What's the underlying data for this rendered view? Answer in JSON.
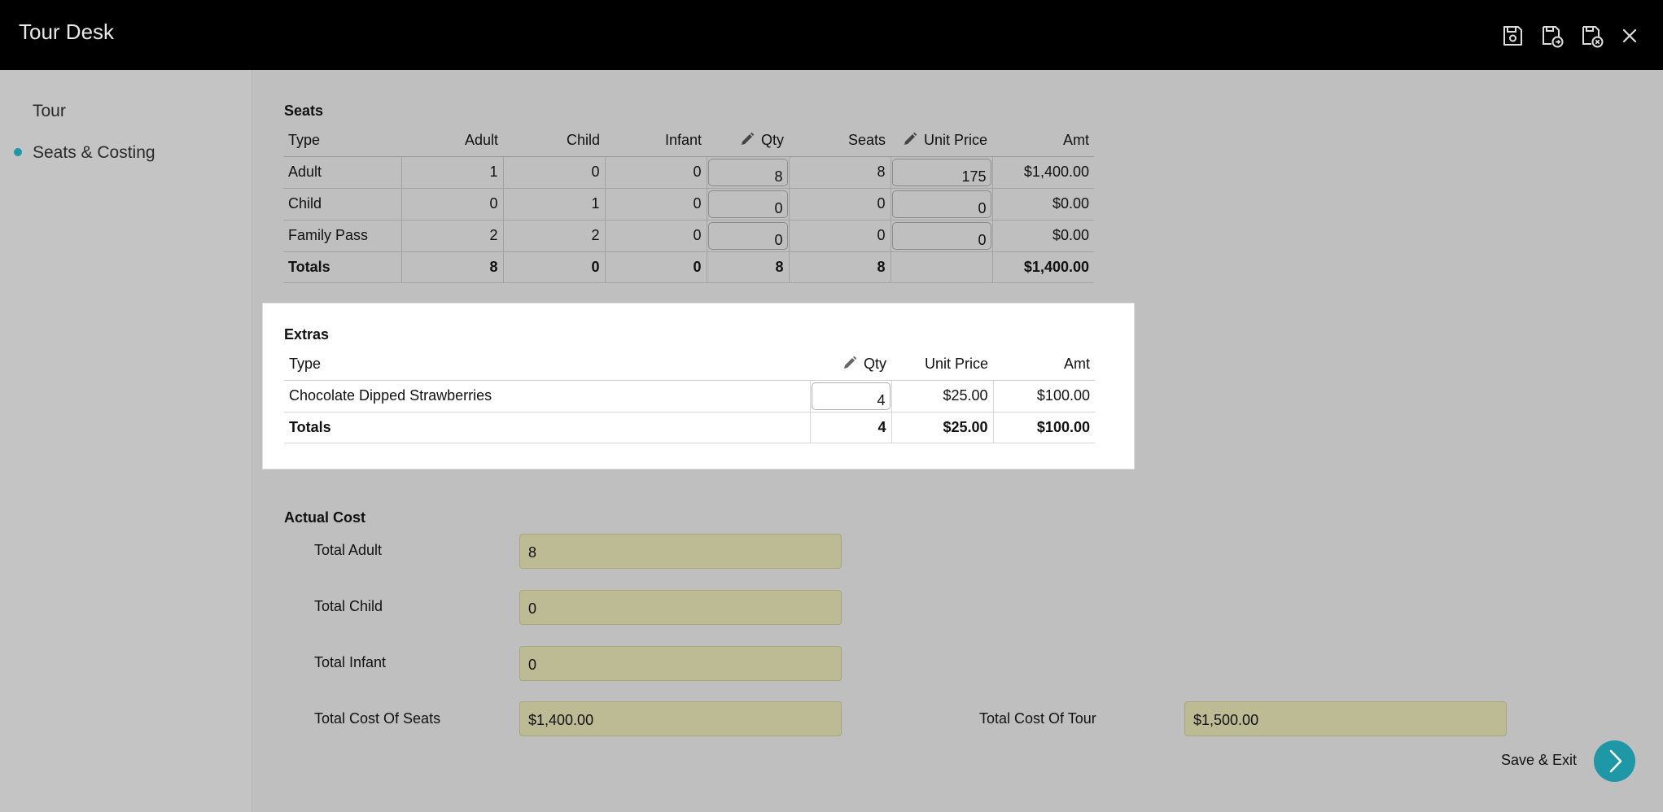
{
  "app": {
    "title": "Tour Desk"
  },
  "toolbar": {
    "icons": [
      "save-icon",
      "save-and-new-icon",
      "save-and-close-icon",
      "close-icon"
    ]
  },
  "sidebar": {
    "items": [
      {
        "label": "Tour",
        "active": false
      },
      {
        "label": "Seats & Costing",
        "active": true
      }
    ]
  },
  "seats": {
    "title": "Seats",
    "headers": {
      "type": "Type",
      "adult": "Adult",
      "child": "Child",
      "infant": "Infant",
      "qty": "Qty",
      "seats": "Seats",
      "unit_price": "Unit Price",
      "amt": "Amt"
    },
    "rows": [
      {
        "type": "Adult",
        "adult": "1",
        "child": "0",
        "infant": "0",
        "qty": "8",
        "seats": "8",
        "unit_price": "175",
        "amt": "$1,400.00"
      },
      {
        "type": "Child",
        "adult": "0",
        "child": "1",
        "infant": "0",
        "qty": "0",
        "seats": "0",
        "unit_price": "0",
        "amt": "$0.00"
      },
      {
        "type": "Family Pass",
        "adult": "2",
        "child": "2",
        "infant": "0",
        "qty": "0",
        "seats": "0",
        "unit_price": "0",
        "amt": "$0.00"
      }
    ],
    "totals": {
      "label": "Totals",
      "adult": "8",
      "child": "0",
      "infant": "0",
      "qty": "8",
      "seats": "8",
      "unit_price": "",
      "amt": "$1,400.00"
    }
  },
  "extras": {
    "title": "Extras",
    "headers": {
      "type": "Type",
      "qty": "Qty",
      "unit_price": "Unit Price",
      "amt": "Amt"
    },
    "rows": [
      {
        "type": "Chocolate Dipped Strawberries",
        "qty": "4",
        "unit_price": "$25.00",
        "amt": "$100.00"
      }
    ],
    "totals": {
      "label": "Totals",
      "qty": "4",
      "unit_price": "$25.00",
      "amt": "$100.00"
    }
  },
  "actual_cost": {
    "title": "Actual Cost",
    "total_adult": {
      "label": "Total Adult",
      "value": "8"
    },
    "total_child": {
      "label": "Total Child",
      "value": "0"
    },
    "total_infant": {
      "label": "Total Infant",
      "value": "0"
    },
    "total_cost_of_seats": {
      "label": "Total Cost Of Seats",
      "value": "$1,400.00"
    },
    "total_cost_of_tour": {
      "label": "Total Cost Of Tour",
      "value": "$1,500.00"
    }
  },
  "footer": {
    "save_exit_label": "Save & Exit"
  },
  "colors": {
    "accent": "#1e97a6",
    "readonly_field": "#bdbb94",
    "topbar": "#000000"
  }
}
